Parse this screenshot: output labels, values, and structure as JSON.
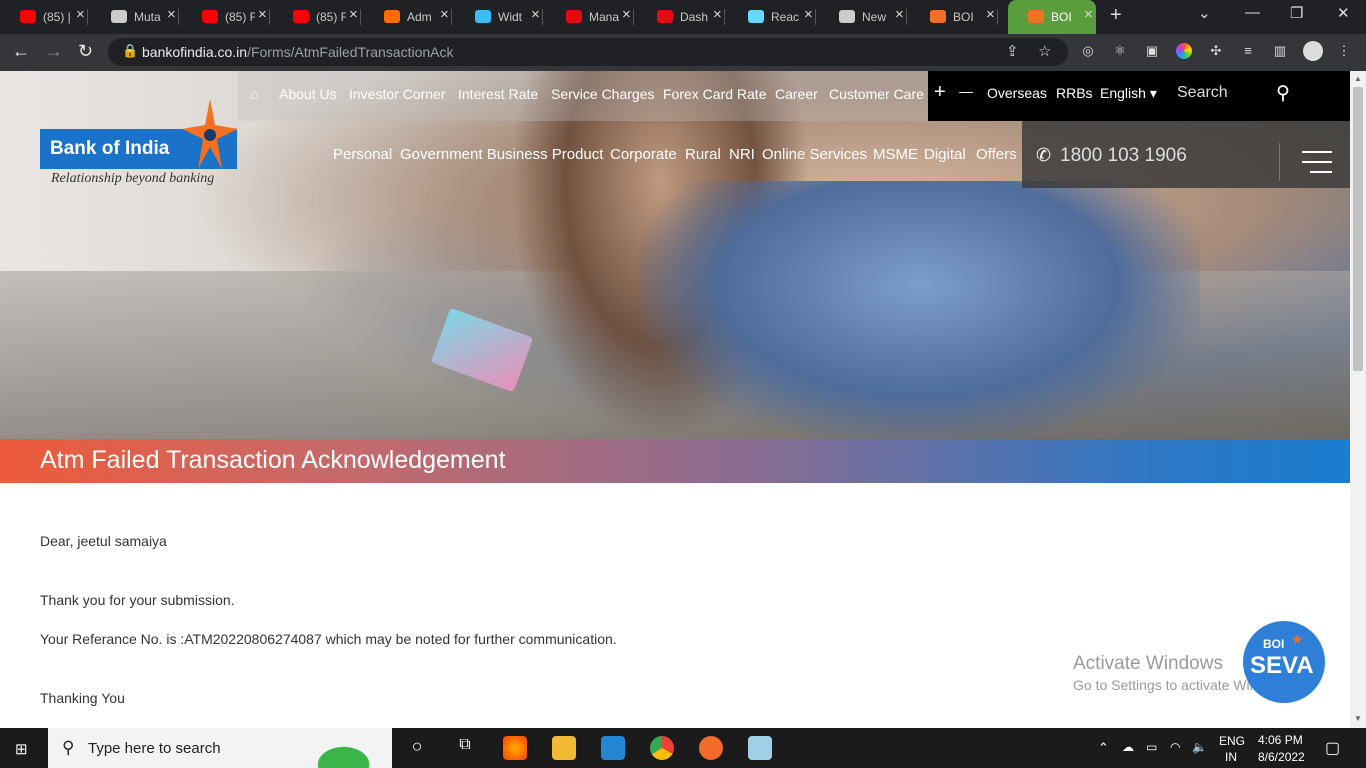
{
  "browser": {
    "tabs": [
      {
        "title": "(85) | ",
        "icon": "youtube-icon",
        "color": "#ff0000"
      },
      {
        "title": "Muta",
        "icon": "globe-icon",
        "color": "#cccccc"
      },
      {
        "title": "(85) F",
        "icon": "youtube-icon",
        "color": "#ff0000"
      },
      {
        "title": "(85) F",
        "icon": "youtube-icon",
        "color": "#ff0000"
      },
      {
        "title": "Adm",
        "icon": "app-icon",
        "color": "#ff6a00"
      },
      {
        "title": "Widt",
        "icon": "tailwind-icon",
        "color": "#38bdf8"
      },
      {
        "title": "Mana",
        "icon": "netflix-icon",
        "color": "#e50914"
      },
      {
        "title": "Dash",
        "icon": "netflix-icon",
        "color": "#e50914"
      },
      {
        "title": "Reac",
        "icon": "react-icon",
        "color": "#61dafb"
      },
      {
        "title": "New",
        "icon": "chrome-icon",
        "color": "#cccccc"
      },
      {
        "title": "BOI",
        "icon": "boi-star-icon",
        "color": "#f37021"
      },
      {
        "title": "BOI",
        "icon": "boi-star-icon",
        "color": "#f37021",
        "active": true
      }
    ],
    "url_host": "bankofindia.co.in",
    "url_path": "/Forms/AtmFailedTransactionAck"
  },
  "site": {
    "logo_text": "Bank of India",
    "tagline": "Relationship beyond banking",
    "top_nav": [
      "About Us",
      "Investor Corner",
      "Interest Rate",
      "Service Charges",
      "Forex Card Rate",
      "Career",
      "Customer Care"
    ],
    "top_right": {
      "plus": "+",
      "minus": "—",
      "overseas": "Overseas",
      "rrbs": "RRBs",
      "language": "English",
      "search": "Search"
    },
    "main_nav": [
      "Personal",
      "Government Business Product",
      "Corporate",
      "Rural",
      "NRI",
      "Online Services",
      "MSME",
      "Digital",
      "Offers"
    ],
    "phone": "1800 103 1906",
    "page_title": "Atm Failed Transaction Acknowledgement"
  },
  "content": {
    "greeting": "Dear, jeetul samaiya",
    "thanks": "Thank you for your submission.",
    "reference": "Your Referance No. is :ATM20220806274087 which may be noted for further communication.",
    "closing": "Thanking You"
  },
  "overlay": {
    "activate_title": "Activate Windows",
    "activate_sub": "Go to Settings to activate Windows.",
    "seva_top": "BOI",
    "seva_main": "SEVA"
  },
  "taskbar": {
    "search_placeholder": "Type here to search",
    "lang1": "ENG",
    "lang2": "IN",
    "time": "4:06 PM",
    "date": "8/6/2022"
  }
}
